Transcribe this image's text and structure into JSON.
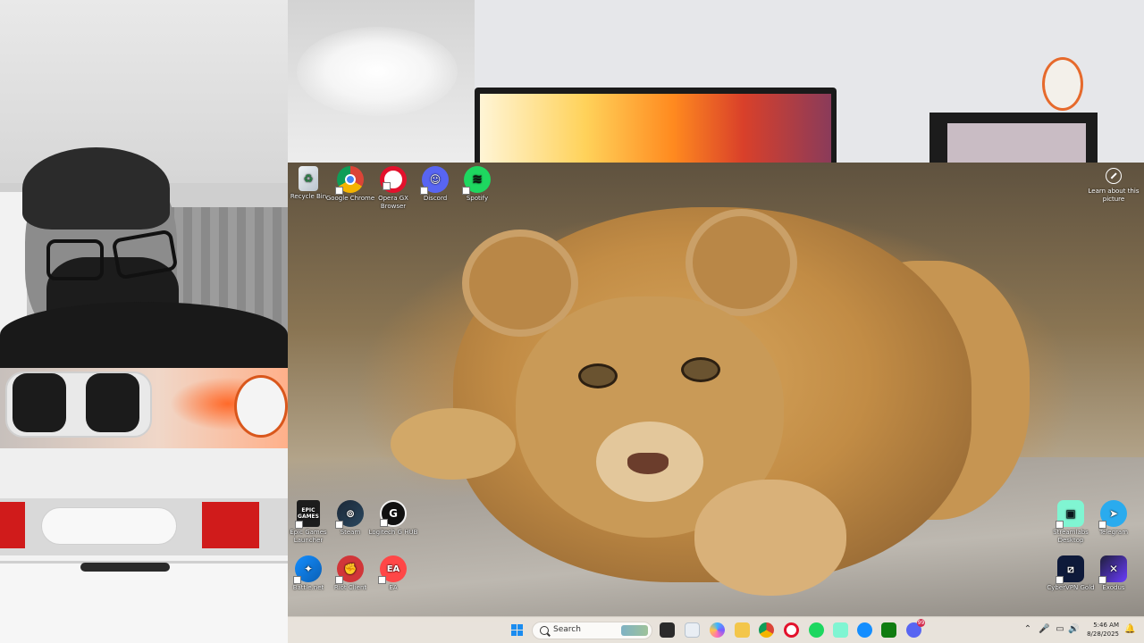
{
  "desktop": {
    "icons_top": [
      {
        "name": "recycle-bin",
        "label": "Recycle Bin"
      },
      {
        "name": "google-chrome",
        "label": "Google Chrome"
      },
      {
        "name": "opera-gx",
        "label": "Opera GX Browser"
      },
      {
        "name": "discord",
        "label": "Discord"
      },
      {
        "name": "spotify",
        "label": "Spotify"
      }
    ],
    "icons_bottom_left": [
      {
        "name": "epic-games",
        "label": "Epic Games Launcher",
        "glyph": "EPIC GAMES"
      },
      {
        "name": "steam",
        "label": "Steam"
      },
      {
        "name": "logitech",
        "label": "Logitech G HUB",
        "glyph": "G"
      },
      {
        "name": "battlenet",
        "label": "Battle.net"
      },
      {
        "name": "riot",
        "label": "Riot Client"
      },
      {
        "name": "ea",
        "label": "EA",
        "glyph": "EA"
      }
    ],
    "icons_bottom_right": [
      {
        "name": "streamlabs",
        "label": "Streamlabs Desktop"
      },
      {
        "name": "telegram",
        "label": "Telegram"
      },
      {
        "name": "cyberghost",
        "label": "CyberVPN Gold"
      },
      {
        "name": "exodus",
        "label": "Exodus"
      }
    ],
    "learn_about": "Learn about this picture"
  },
  "taskbar": {
    "search_placeholder": "Search",
    "time": "5:46 AM",
    "date": "8/28/2025",
    "notification_count": "99"
  },
  "colors": {
    "accent": "#1a8cf0",
    "taskbar_bg": "#ece6de"
  }
}
